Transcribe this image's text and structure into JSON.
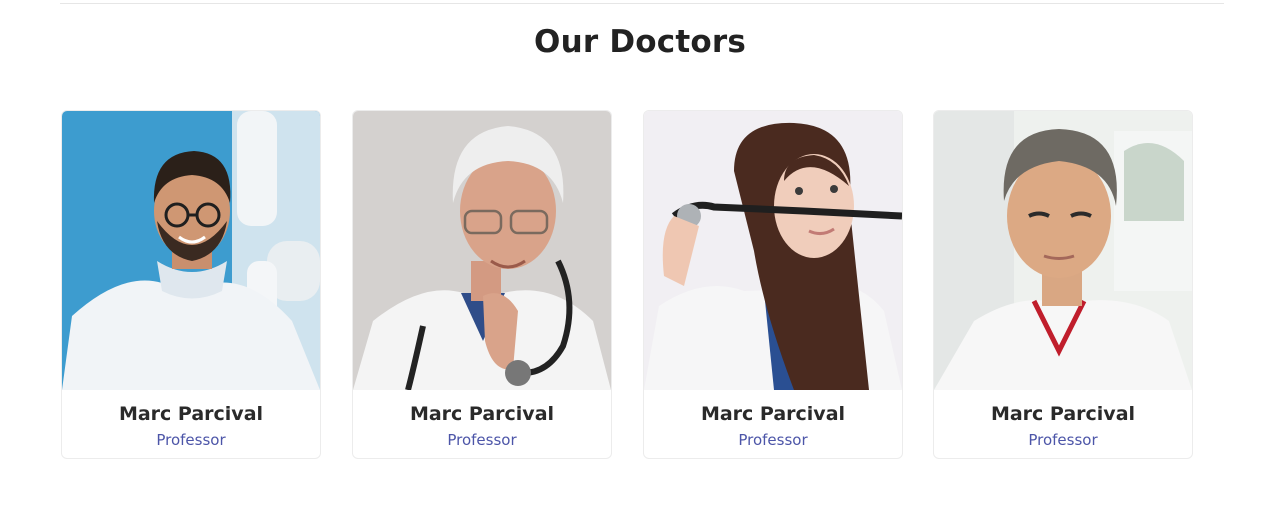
{
  "section": {
    "title": "Our Doctors"
  },
  "doctors": [
    {
      "name": "Marc Parcival",
      "role": "Professor",
      "photo_icon": "doctor-photo-young-man-glasses"
    },
    {
      "name": "Marc Parcival",
      "role": "Professor",
      "photo_icon": "doctor-photo-senior-man-stethoscope"
    },
    {
      "name": "Marc Parcival",
      "role": "Professor",
      "photo_icon": "doctor-photo-woman-stethoscope"
    },
    {
      "name": "Marc Parcival",
      "role": "Professor",
      "photo_icon": "doctor-photo-man-polo"
    }
  ],
  "colors": {
    "title": "#222222",
    "name": "#2a2a2a",
    "role": "#4c55a8",
    "card_border": "#ececec"
  }
}
